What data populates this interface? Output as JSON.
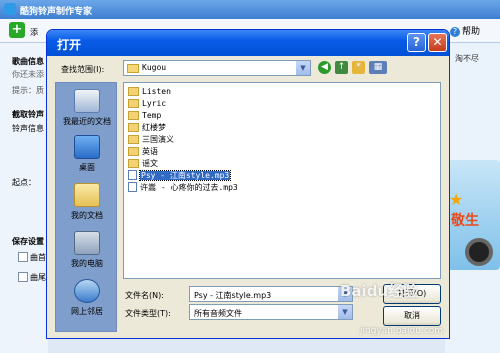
{
  "background_app": {
    "title": "酷狗铃声制作专家",
    "toolbar": {
      "add_label": "添",
      "help_label": "帮助"
    },
    "left_panel": {
      "song_info_label": "歌曲信息",
      "hint_line": "你还未添",
      "tip_line": "提示：质",
      "cut_label": "截取铃声",
      "ringtone_info_label": "铃声信息",
      "start_point_label": "起点：",
      "save_settings_label": "保存设置",
      "option1_label": "曲首",
      "option2_label": "曲尾"
    },
    "right_panel": {
      "tagline": "淘不尽",
      "promo_text": "敬生"
    }
  },
  "dialog": {
    "title": "打开",
    "look_in_label": "查找范围(I):",
    "look_in_value": "Kugou",
    "places": [
      {
        "label": "我最近的文档",
        "icon": "recent-docs-icon"
      },
      {
        "label": "桌面",
        "icon": "desktop-icon"
      },
      {
        "label": "我的文档",
        "icon": "my-documents-icon"
      },
      {
        "label": "我的电脑",
        "icon": "my-computer-icon"
      },
      {
        "label": "网上邻居",
        "icon": "network-icon"
      }
    ],
    "files": [
      {
        "name": "Listen",
        "type": "folder"
      },
      {
        "name": "Lyric",
        "type": "folder"
      },
      {
        "name": "Temp",
        "type": "folder"
      },
      {
        "name": "红楼梦",
        "type": "folder"
      },
      {
        "name": "三国演义",
        "type": "folder"
      },
      {
        "name": "英语",
        "type": "folder"
      },
      {
        "name": "谣文",
        "type": "folder"
      },
      {
        "name": "Psy - 江南style.mp3",
        "type": "file",
        "selected": true
      },
      {
        "name": "许嵩 - 心疼你的过去.mp3",
        "type": "file"
      }
    ],
    "filename_label": "文件名(N):",
    "filename_value": "Psy - 江南style.mp3",
    "filetype_label": "文件类型(T):",
    "filetype_value": "所有音频文件",
    "open_button": "打开(O)",
    "cancel_button": "取消"
  },
  "watermark": {
    "main": "Baidu经验",
    "sub": "jingyan.baidu.com"
  }
}
